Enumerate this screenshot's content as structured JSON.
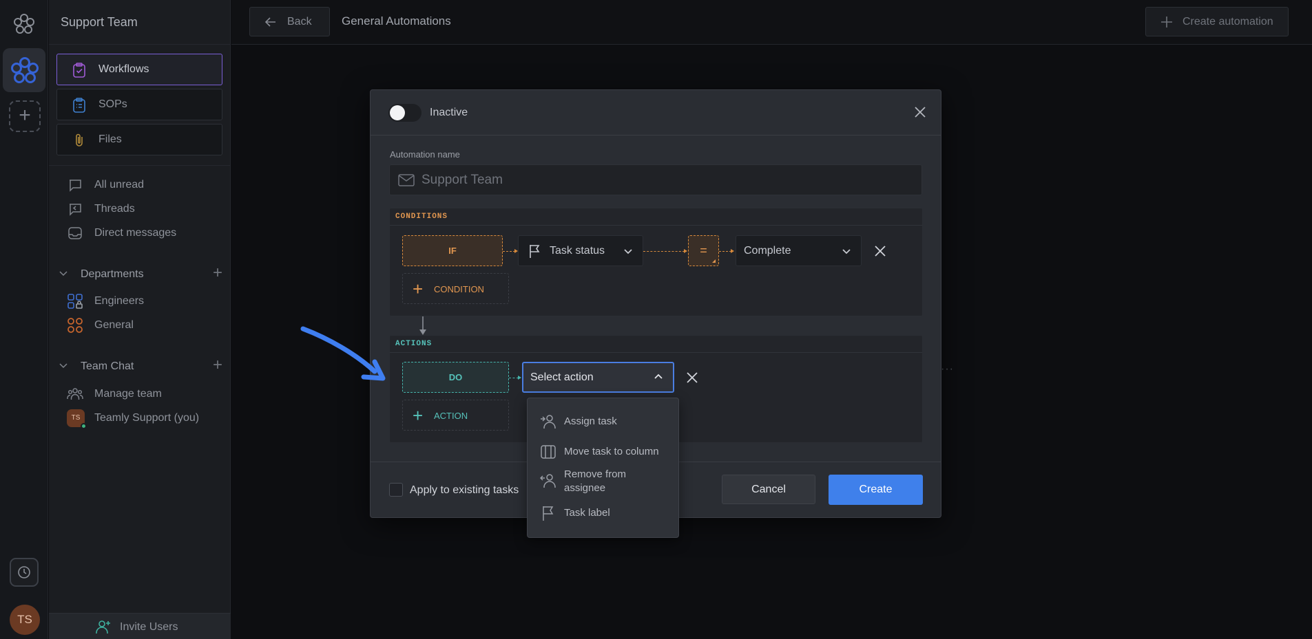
{
  "rail": {
    "avatar_initials": "TS"
  },
  "sidebar": {
    "title": "Support Team",
    "nav": [
      {
        "label": "Workflows",
        "icon": "clipboard-check-icon",
        "active": true
      },
      {
        "label": "SOPs",
        "icon": "clipboard-list-icon",
        "active": false
      },
      {
        "label": "Files",
        "icon": "paperclip-icon",
        "active": false
      }
    ],
    "links": [
      {
        "label": "All unread",
        "icon": "chat-bubble-icon"
      },
      {
        "label": "Threads",
        "icon": "threads-icon"
      },
      {
        "label": "Direct messages",
        "icon": "inbox-icon"
      }
    ],
    "departments": {
      "label": "Departments",
      "items": [
        {
          "label": "Engineers",
          "icon": "locked-grid-icon"
        },
        {
          "label": "General",
          "icon": "circles-grid-icon"
        }
      ]
    },
    "team_chat": {
      "label": "Team Chat",
      "items": [
        {
          "label": "Manage team",
          "icon": "team-icon"
        },
        {
          "label": "Teamly Support (you)",
          "avatar": "TS"
        }
      ]
    },
    "invite_label": "Invite Users"
  },
  "topbar": {
    "back_label": "Back",
    "title": "General Automations",
    "create_label": "Create automation"
  },
  "modal": {
    "toggle_label": "Inactive",
    "name_label": "Automation name",
    "name_placeholder": "Support Team",
    "conditions": {
      "title": "CONDITIONS",
      "if_label": "IF",
      "field": "Task status",
      "operator": "=",
      "value": "Complete",
      "add_label": "CONDITION"
    },
    "actions": {
      "title": "ACTIONS",
      "do_label": "DO",
      "select_label": "Select action",
      "add_label": "ACTION"
    },
    "apply_label": "Apply to existing tasks",
    "cancel_label": "Cancel",
    "create_label": "Create"
  },
  "menu": {
    "items": [
      {
        "label": "Assign task",
        "icon": "assign-user-icon"
      },
      {
        "label": "Move task to column",
        "icon": "columns-icon"
      },
      {
        "label": "Remove from assignee",
        "icon": "remove-user-icon"
      },
      {
        "label": "Task label",
        "icon": "flag-icon"
      }
    ]
  },
  "colors": {
    "accent_blue": "#3f80eb",
    "condition_orange": "#d88a3c",
    "action_teal": "#46b5ad",
    "workflow_purple": "#7b5fd6"
  }
}
